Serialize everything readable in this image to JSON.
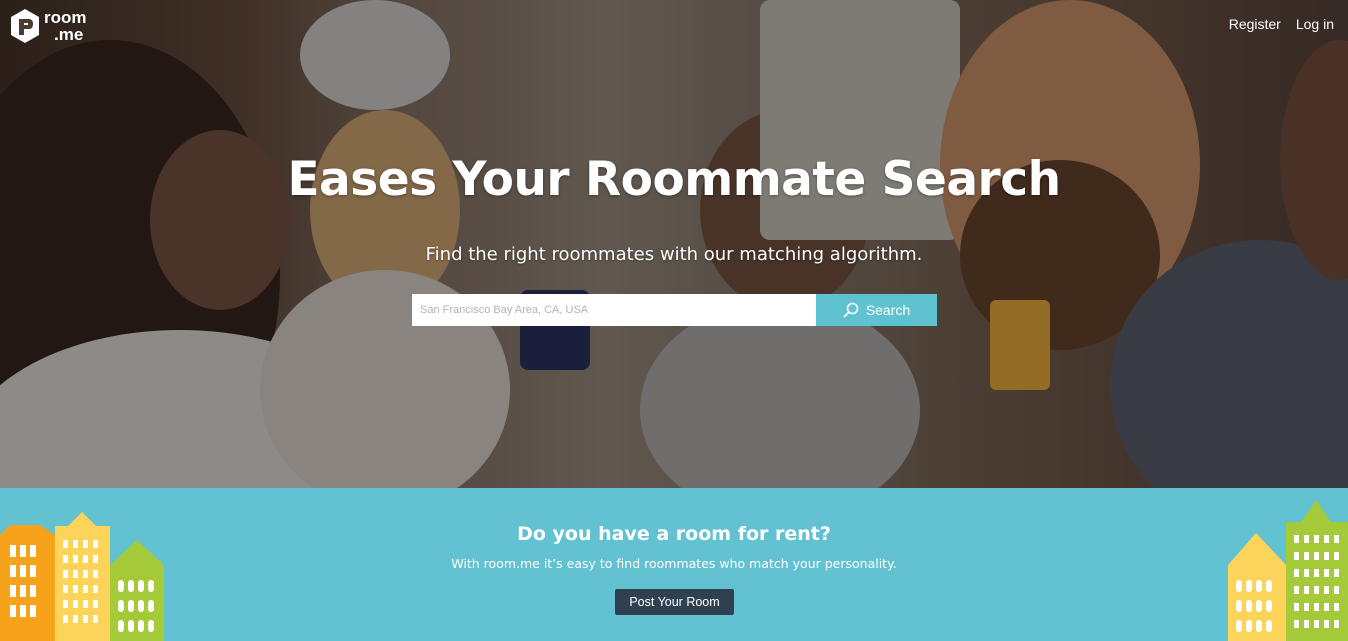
{
  "brand": {
    "line1": "room",
    "line2": ".me"
  },
  "nav": {
    "register": "Register",
    "login": "Log in"
  },
  "hero": {
    "title": "Eases Your Roommate Search",
    "subtitle": "Find the right roommates with our matching algorithm.",
    "search_placeholder": "San Francisco Bay Area, CA, USA",
    "search_button": "Search"
  },
  "rent": {
    "title": "Do you have a room for rent?",
    "subtitle": "With room.me it’s easy to find roommates who match your personality.",
    "button": "Post Your Room"
  },
  "colors": {
    "accent": "#5fc2d0",
    "band": "#62c2d1",
    "button_dark": "#2f4150",
    "building_orange": "#f7a21b",
    "building_yellow": "#fdd45a",
    "building_green": "#a4c939"
  },
  "icons": {
    "logo": "room-me-logo-icon",
    "search": "magnifier-icon"
  }
}
